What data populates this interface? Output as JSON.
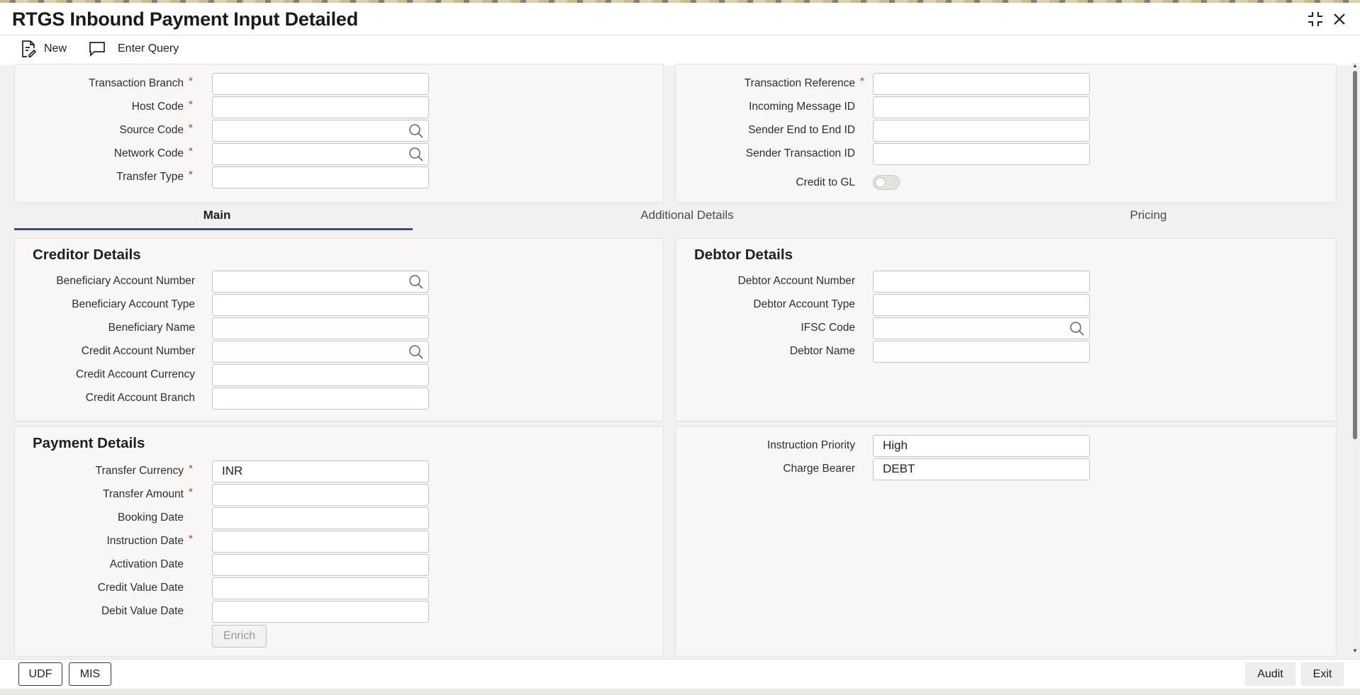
{
  "window": {
    "title": "RTGS Inbound Payment Input Detailed"
  },
  "toolbar": {
    "new_label": "New",
    "enter_query_label": "Enter Query"
  },
  "header_left": {
    "fields": [
      {
        "label": "Transaction Branch",
        "required": true,
        "value": "",
        "lookup": false
      },
      {
        "label": "Host Code",
        "required": true,
        "value": "",
        "lookup": false
      },
      {
        "label": "Source Code",
        "required": true,
        "value": "",
        "lookup": true
      },
      {
        "label": "Network Code",
        "required": true,
        "value": "",
        "lookup": true
      },
      {
        "label": "Transfer Type",
        "required": true,
        "value": "",
        "lookup": false
      }
    ]
  },
  "header_right": {
    "fields": [
      {
        "label": "Transaction Reference",
        "required": true,
        "value": ""
      },
      {
        "label": "Incoming Message ID",
        "required": false,
        "value": ""
      },
      {
        "label": "Sender End to End ID",
        "required": false,
        "value": ""
      },
      {
        "label": "Sender Transaction ID",
        "required": false,
        "value": ""
      }
    ],
    "credit_to_gl": {
      "label": "Credit to GL",
      "on": false
    }
  },
  "tabs": [
    {
      "label": "Main",
      "active": true
    },
    {
      "label": "Additional Details",
      "active": false
    },
    {
      "label": "Pricing",
      "active": false
    }
  ],
  "creditor": {
    "title": "Creditor Details",
    "fields": [
      {
        "label": "Beneficiary Account Number",
        "value": "",
        "lookup": true
      },
      {
        "label": "Beneficiary Account Type",
        "value": "",
        "lookup": false
      },
      {
        "label": "Beneficiary Name",
        "value": "",
        "lookup": false
      },
      {
        "label": "Credit Account Number",
        "value": "",
        "lookup": true
      },
      {
        "label": "Credit Account Currency",
        "value": "",
        "lookup": false
      },
      {
        "label": "Credit Account Branch",
        "value": "",
        "lookup": false
      }
    ]
  },
  "debtor": {
    "title": "Debtor Details",
    "fields": [
      {
        "label": "Debtor Account Number",
        "value": "",
        "lookup": false
      },
      {
        "label": "Debtor Account Type",
        "value": "",
        "lookup": false
      },
      {
        "label": "IFSC Code",
        "value": "",
        "lookup": true
      },
      {
        "label": "Debtor Name",
        "value": "",
        "lookup": false
      }
    ]
  },
  "payment": {
    "title": "Payment Details",
    "fields": [
      {
        "label": "Transfer Currency",
        "required": true,
        "value": "INR"
      },
      {
        "label": "Transfer Amount",
        "required": true,
        "value": ""
      },
      {
        "label": "Booking Date",
        "required": false,
        "value": ""
      },
      {
        "label": "Instruction Date",
        "required": true,
        "value": ""
      },
      {
        "label": "Activation Date",
        "required": false,
        "value": ""
      },
      {
        "label": "Credit Value Date",
        "required": false,
        "value": ""
      },
      {
        "label": "Debit Value Date",
        "required": false,
        "value": ""
      }
    ],
    "enrich_label": "Enrich"
  },
  "payment_right": {
    "fields": [
      {
        "label": "Instruction Priority",
        "value": "High"
      },
      {
        "label": "Charge Bearer",
        "value": "DEBT"
      }
    ]
  },
  "footer": {
    "udf_label": "UDF",
    "mis_label": "MIS",
    "audit_label": "Audit",
    "exit_label": "Exit"
  },
  "colors": {
    "required_marker": "#d0342c",
    "active_tab_underline": "#3d4e6e"
  },
  "icons": {
    "new": "new-document-icon",
    "enter_query": "chat-query-icon",
    "lookup": "search-icon",
    "minimize": "collapse-icon",
    "close": "close-icon"
  }
}
